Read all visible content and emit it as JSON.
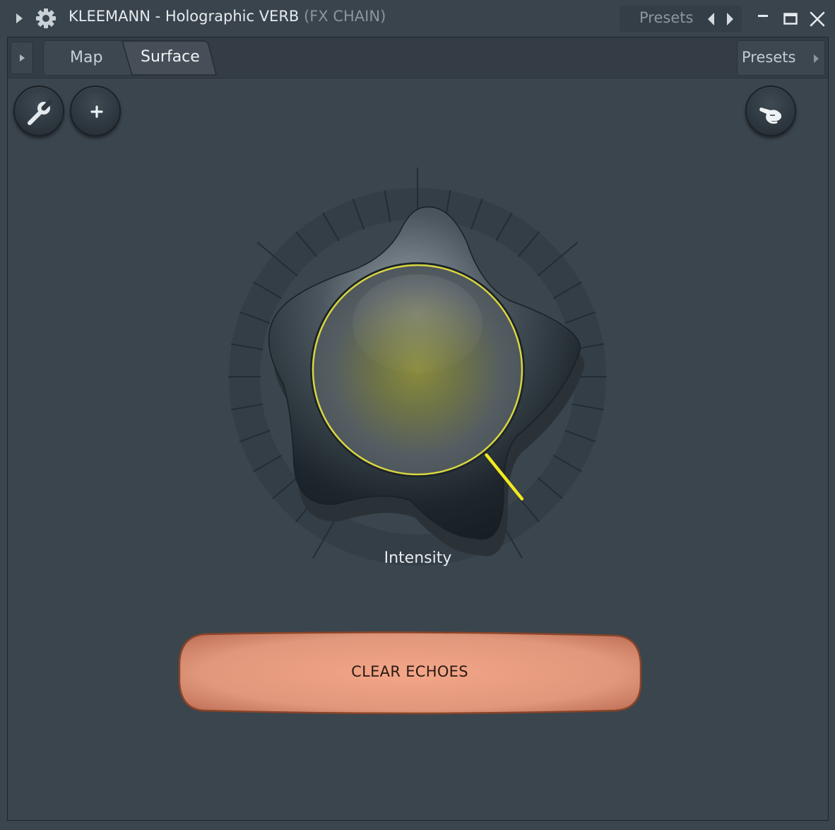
{
  "window": {
    "title": "KLEEMANN - Holographic VERB",
    "subtitle": "(FX CHAIN)",
    "presets_label": "Presets"
  },
  "tabs": [
    {
      "label": "Map",
      "active": false
    },
    {
      "label": "Surface",
      "active": true
    }
  ],
  "toolbar": {
    "presets_label": "Presets"
  },
  "knob": {
    "label": "Intensity",
    "value": 0.97,
    "accent_color": "#f2ea1c"
  },
  "clear_button": {
    "label": "CLEAR ECHOES",
    "color": "#e99b7e"
  },
  "icons": {
    "settings": "wrench-icon",
    "add": "plus-icon",
    "touch": "pointing-hand-icon"
  }
}
